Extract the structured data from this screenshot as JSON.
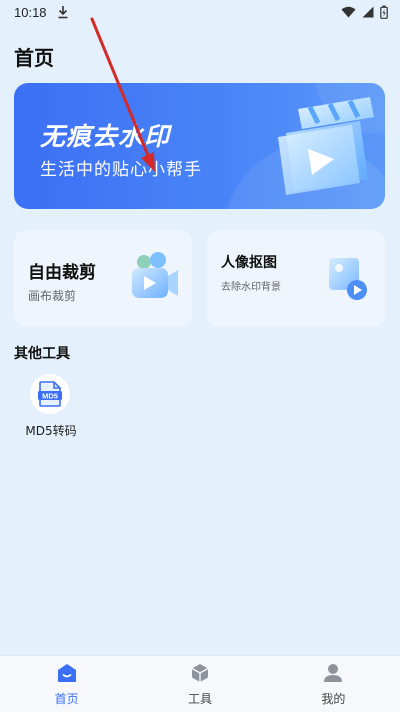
{
  "status_bar": {
    "time": "10:18"
  },
  "page_title": "首页",
  "banner": {
    "title": "无痕去水印",
    "subtitle": "生活中的贴心小帮手"
  },
  "cards": {
    "crop": {
      "title": "自由裁剪",
      "subtitle": "画布裁剪"
    },
    "matting": {
      "title": "人像抠图",
      "subtitle": "去除水印背景"
    }
  },
  "other_tools": {
    "title": "其他工具",
    "items": [
      {
        "label": "MD5转码",
        "icon_text": "MD5"
      }
    ]
  },
  "bottom_nav": {
    "items": [
      {
        "label": "首页",
        "icon": "home-icon",
        "active": true
      },
      {
        "label": "工具",
        "icon": "cube-icon",
        "active": false
      },
      {
        "label": "我的",
        "icon": "person-icon",
        "active": false
      }
    ]
  },
  "colors": {
    "accent": "#3b6ff5",
    "background": "#e4f0fb",
    "annotation_arrow": "#d42a2a"
  }
}
